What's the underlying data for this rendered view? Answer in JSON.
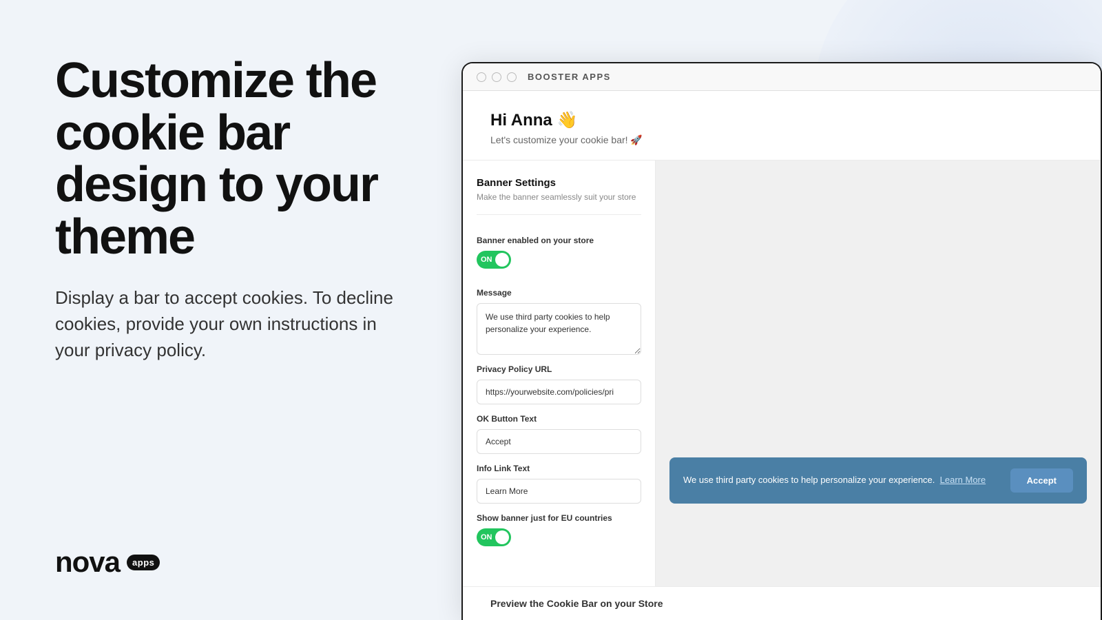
{
  "left": {
    "headline": "Customize the cookie bar design to your theme",
    "subtext": "Display a bar to accept cookies. To decline cookies, provide your own instructions in your privacy policy.",
    "logo": {
      "text": "nova",
      "badge": "apps"
    }
  },
  "browser": {
    "dots": [
      "dot1",
      "dot2",
      "dot3"
    ],
    "brand": "BOOSTER APPS"
  },
  "app": {
    "greeting": "Hi Anna 👋",
    "greeting_sub": "Let's customize your cookie bar! 🚀",
    "settings": {
      "section_title": "Banner Settings",
      "section_desc": "Make the banner seamlessly suit your store",
      "banner_enabled_label": "Banner enabled on your store",
      "banner_enabled_state": "ON",
      "message_label": "Message",
      "message_value": "We use third party cookies to help personalize your experience.",
      "privacy_url_label": "Privacy Policy URL",
      "privacy_url_value": "https://yourwebsite.com/policies/pri",
      "ok_button_label": "OK Button Text",
      "ok_button_value": "Accept",
      "info_link_label": "Info Link Text",
      "info_link_value": "Learn More",
      "eu_label": "Show banner just for EU countries",
      "eu_state": "ON"
    },
    "preview": {
      "cookie_message": "We use third party cookies to help personalize your experience.",
      "learn_more": "Learn More",
      "accept_btn": "Accept"
    },
    "bottom": {
      "title": "Preview the Cookie Bar on your Store"
    }
  }
}
